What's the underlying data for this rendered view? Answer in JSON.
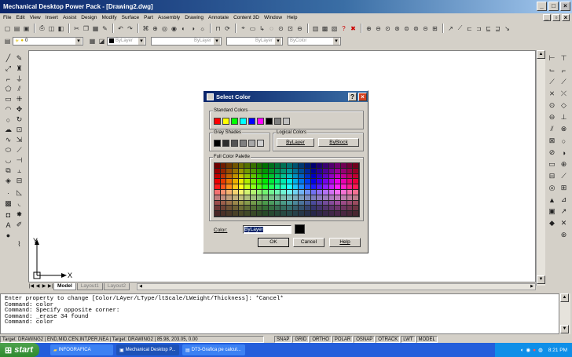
{
  "window": {
    "title": "Mechanical Desktop Power Pack - [Drawing2.dwg]"
  },
  "menu": [
    "File",
    "Edit",
    "View",
    "Insert",
    "Assist",
    "Design",
    "Modify",
    "Surface",
    "Part",
    "Assembly",
    "Drawing",
    "Annotate",
    "Content 3D",
    "Window",
    "Help"
  ],
  "layers": {
    "current_layer": "0",
    "color": "ByLayer",
    "linetype": "ByLayer",
    "lineweight": "ByLayer",
    "plotstyle": "ByColor"
  },
  "ucs": {
    "y_label": "Y",
    "x_label": "X"
  },
  "layout_tabs": [
    "Model",
    "Layout1",
    "Layout2"
  ],
  "dialog": {
    "title": "Select Color",
    "standard_label": "Standard Colors",
    "standard_colors": [
      "#ff0000",
      "#ffff00",
      "#00ff00",
      "#00ffff",
      "#0000ff",
      "#ff00ff",
      "#000000",
      "#808080",
      "#c0c0c0"
    ],
    "gray_label": "Gray Shades",
    "gray_colors": [
      "#000000",
      "#2e2e2e",
      "#545454",
      "#808080",
      "#a8a8a8",
      "#d0d0d0"
    ],
    "logical_label": "Logical Colors",
    "bylayer_btn": "ByLayer",
    "byblock_btn": "ByBlock",
    "palette_label": "Full Color Palette",
    "color_label": "Color:",
    "color_value": "ByLayer",
    "color_preview": "#000000",
    "ok": "OK",
    "cancel": "Cancel",
    "help": "Help"
  },
  "command_lines": [
    "Enter property to change [Color/LAyer/LType/ltScale/LWeight/Thickness]: *Cancel*",
    "Command: color",
    "Command: Specify opposite corner:",
    "Command: _erase 34 found",
    "Command: color"
  ],
  "status": {
    "target_left": "Target: DRAWING2 | END,MID,CEN,INT,PER,NEA | Target: DRAWING2 | 85.98,  203.05, 0.00",
    "toggles": [
      "SNAP",
      "GRID",
      "ORTHO",
      "POLAR",
      "OSNAP",
      "OTRACK",
      "LWT",
      "MODEL"
    ]
  },
  "taskbar": {
    "start": "start",
    "tasks": [
      "INFOGRAFICA",
      "Mechanical Desktop P...",
      "DT3-Grafica pe calcul..."
    ],
    "clock": "8:21 PM"
  }
}
